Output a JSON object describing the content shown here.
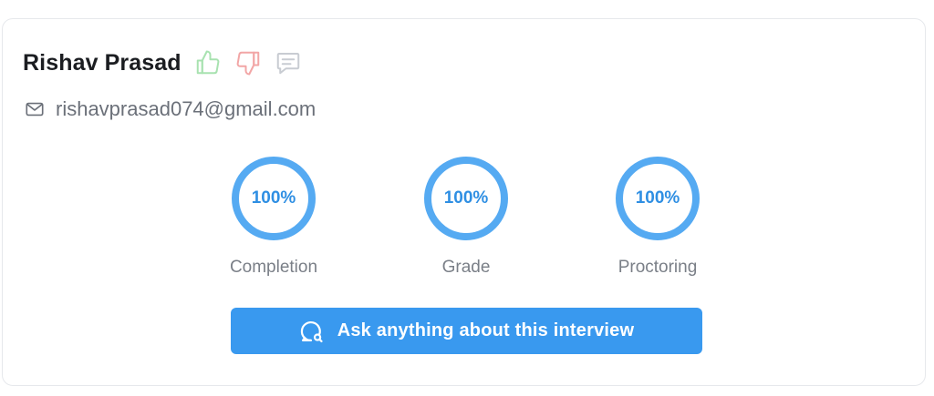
{
  "candidate": {
    "name": "Rishav Prasad",
    "email": "rishavprasad074@gmail.com"
  },
  "icons": {
    "thumbs_up": "thumbs-up-icon",
    "thumbs_down": "thumbs-down-icon",
    "comment": "comment-icon",
    "mail": "mail-icon",
    "chat_search": "chat-search-icon"
  },
  "metrics": [
    {
      "label": "Completion",
      "value_text": "100%",
      "value": 1.0
    },
    {
      "label": "Grade",
      "value_text": "100%",
      "value": 1.0
    },
    {
      "label": "Proctoring",
      "value_text": "100%",
      "value": 1.0
    }
  ],
  "actions": {
    "ask_label": "Ask anything about this interview"
  },
  "colors": {
    "accent": "#3999ef",
    "ring": "#55aaf2",
    "ring_text": "#2f8fe3",
    "thumbs_up": "#a8e2b0",
    "thumbs_down": "#f2a6a6",
    "comment": "#c8ccd2"
  }
}
